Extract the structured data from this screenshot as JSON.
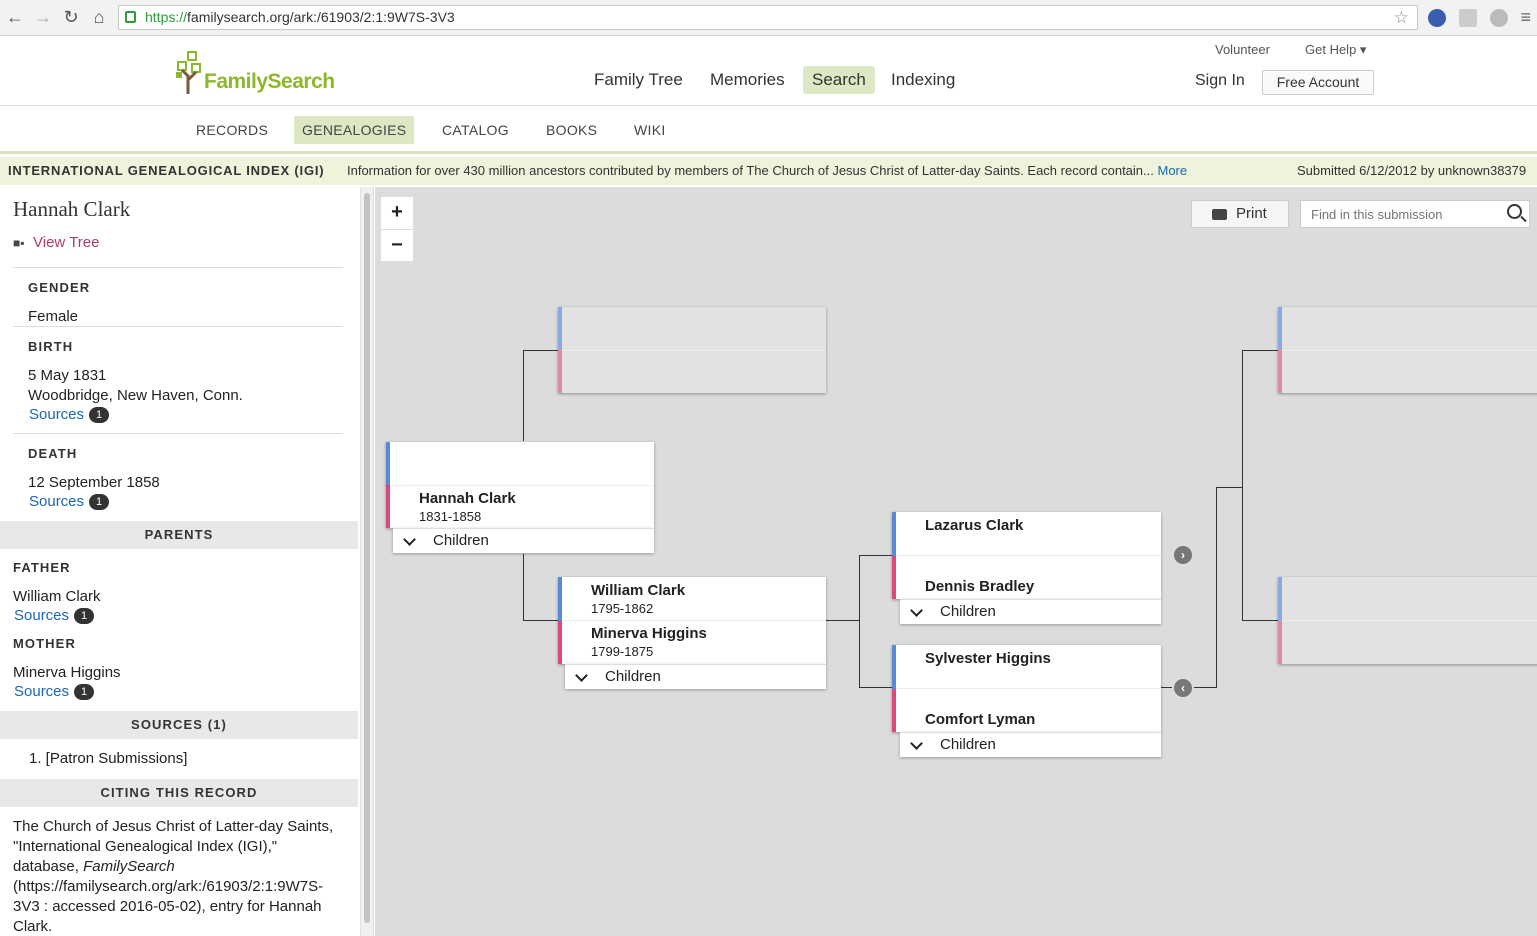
{
  "browser": {
    "url_scheme": "https://",
    "url_rest": "familysearch.org/ark:/61903/2:1:9W7S-3V3"
  },
  "header": {
    "logo": "FamilySearch",
    "nav": [
      "Family Tree",
      "Memories",
      "Search",
      "Indexing"
    ],
    "active_nav": "Search",
    "volunteer": "Volunteer",
    "get_help": "Get Help ▾",
    "sign_in": "Sign In",
    "free_account": "Free Account"
  },
  "subnav": [
    "RECORDS",
    "GENEALOGIES",
    "CATALOG",
    "BOOKS",
    "WIKI"
  ],
  "banner": {
    "title": "INTERNATIONAL GENEALOGICAL INDEX (IGI)",
    "desc": "Information for over 430 million ancestors contributed by members of The Church of Jesus Christ of Latter-day Saints. Each record contain...",
    "more": "More",
    "submitted": "Submitted 6/12/2012 by unknown38379"
  },
  "person": {
    "name": "Hannah Clark",
    "view_tree": "View Tree",
    "gender_label": "GENDER",
    "gender": "Female",
    "birth_label": "BIRTH",
    "birth_date": "5 May 1831",
    "birth_place": "Woodbridge, New Haven, Conn.",
    "death_label": "DEATH",
    "death_date": "12 September 1858",
    "sources_label": "Sources",
    "sources_count": "1",
    "parents_label": "PARENTS",
    "father_label": "FATHER",
    "father": "William Clark",
    "mother_label": "MOTHER",
    "mother": "Minerva Higgins",
    "sources_section": "SOURCES (1)",
    "source_item": "1. [Patron Submissions]",
    "citing_label": "CITING THIS RECORD",
    "cite_part1": "The Church of Jesus Christ of Latter-day Saints, \"International Genealogical Index (IGI),\" database, ",
    "cite_italic": "FamilySearch",
    "cite_part2": " (https://familysearch.org/ark:/61903/2:1:9W7S-3V3 : accessed 2016-05-02), entry for Hannah Clark."
  },
  "tree": {
    "zoom_in": "+",
    "zoom_out": "−",
    "print": "Print",
    "find_placeholder": "Find in this submission",
    "children_label": "Children",
    "focus": {
      "name": "Hannah Clark",
      "dates": "1831-1858"
    },
    "father": {
      "name": "William Clark",
      "dates": "1795-1862"
    },
    "mother": {
      "name": "Minerva Higgins",
      "dates": "1799-1875"
    },
    "gf_paternal": "Lazarus Clark",
    "gm_paternal": "Dennis Bradley",
    "gf_maternal": "Sylvester Higgins",
    "gm_maternal": "Comfort Lyman",
    "nav_right": "›",
    "nav_left": "‹"
  }
}
